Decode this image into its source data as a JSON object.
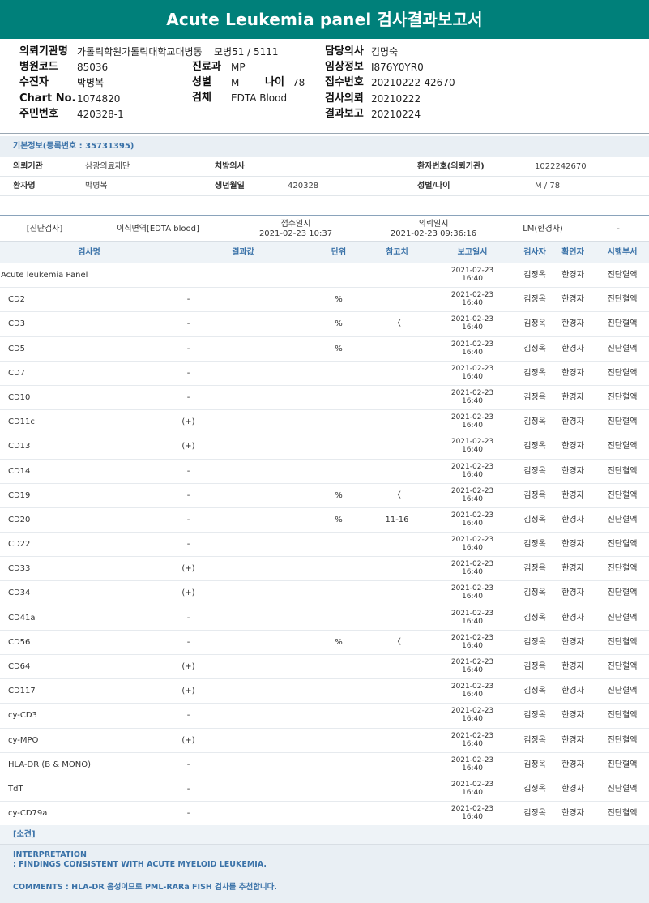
{
  "title": "Acute Leukemia panel 검사결과보고서",
  "header": {
    "institution_label": "의뢰기관명",
    "institution": "가톨릭학원가톨릭대학교대병동",
    "ward": "모병51 / 5111",
    "doctor_label": "담당의사",
    "doctor": "김명숙",
    "hospital_code_label": "병원코드",
    "hospital_code": "85036",
    "dept_label": "진료과",
    "dept": "MP",
    "clinical_label": "임상정보",
    "clinical": "I876Y0YR0",
    "patient_label": "수진자",
    "patient": "박병복",
    "sex_label": "성별",
    "sex": "M",
    "age_label": "나이",
    "age": "78",
    "receipt_label": "접수번호",
    "receipt": "20210222-42670",
    "chart_label": "Chart No.",
    "chart": "1074820",
    "specimen_label": "검체",
    "specimen": "EDTA Blood",
    "request_label": "검사의뢰",
    "request": "20210222",
    "rrn_label": "주민번호",
    "rrn": "420328-1",
    "report_label": "결과보고",
    "report": "20210224"
  },
  "basic": {
    "title": "기본정보(등록번호 : 35731395)",
    "org_label": "의뢰기관",
    "org": "삼광의료재단",
    "presc_label": "처방의사",
    "presc": "",
    "pno_label": "환자번호(의뢰기관)",
    "pno": "1022242670",
    "name_label": "환자명",
    "name": "박병복",
    "birth_label": "생년월일",
    "birth": "420328",
    "sexage_label": "성별/나이",
    "sexage": "M / 78"
  },
  "info": {
    "category": "[진단검사]",
    "specimen": "이식면역[EDTA blood]",
    "receipt_label": "접수일시",
    "receipt": "2021-02-23 10:37",
    "request_label": "의뢰일시",
    "request": "2021-02-23 09:36:16",
    "lm": "LM(한경자)",
    "dash": "-"
  },
  "columns": {
    "name": "검사명",
    "result": "결과값",
    "unit": "단위",
    "ref": "참고치",
    "date": "보고일시",
    "tester": "검사자",
    "checker": "확인자",
    "dept": "시행부서"
  },
  "rows": [
    {
      "name": "Acute leukemia Panel",
      "result": "",
      "unit": "",
      "ref": "",
      "date": "2021-02-23",
      "time": "16:40",
      "tester": "김정옥",
      "checker": "한경자",
      "dept": "진단혈액"
    },
    {
      "name": "CD2",
      "result": "-",
      "unit": "%",
      "ref": "",
      "date": "2021-02-23",
      "time": "16:40",
      "tester": "김정옥",
      "checker": "한경자",
      "dept": "진단혈액"
    },
    {
      "name": "CD3",
      "result": "-",
      "unit": "%",
      "ref": "〈",
      "date": "2021-02-23",
      "time": "16:40",
      "tester": "김정옥",
      "checker": "한경자",
      "dept": "진단혈액"
    },
    {
      "name": "CD5",
      "result": "-",
      "unit": "%",
      "ref": "",
      "date": "2021-02-23",
      "time": "16:40",
      "tester": "김정옥",
      "checker": "한경자",
      "dept": "진단혈액"
    },
    {
      "name": "CD7",
      "result": "-",
      "unit": "",
      "ref": "",
      "date": "2021-02-23",
      "time": "16:40",
      "tester": "김정옥",
      "checker": "한경자",
      "dept": "진단혈액"
    },
    {
      "name": "CD10",
      "result": "-",
      "unit": "",
      "ref": "",
      "date": "2021-02-23",
      "time": "16:40",
      "tester": "김정옥",
      "checker": "한경자",
      "dept": "진단혈액"
    },
    {
      "name": "CD11c",
      "result": "(+)",
      "unit": "",
      "ref": "",
      "date": "2021-02-23",
      "time": "16:40",
      "tester": "김정옥",
      "checker": "한경자",
      "dept": "진단혈액"
    },
    {
      "name": "CD13",
      "result": "(+)",
      "unit": "",
      "ref": "",
      "date": "2021-02-23",
      "time": "16:40",
      "tester": "김정옥",
      "checker": "한경자",
      "dept": "진단혈액"
    },
    {
      "name": "CD14",
      "result": "-",
      "unit": "",
      "ref": "",
      "date": "2021-02-23",
      "time": "16:40",
      "tester": "김정옥",
      "checker": "한경자",
      "dept": "진단혈액"
    },
    {
      "name": "CD19",
      "result": "-",
      "unit": "%",
      "ref": "〈",
      "date": "2021-02-23",
      "time": "16:40",
      "tester": "김정옥",
      "checker": "한경자",
      "dept": "진단혈액"
    },
    {
      "name": "CD20",
      "result": "-",
      "unit": "%",
      "ref": "11-16",
      "date": "2021-02-23",
      "time": "16:40",
      "tester": "김정옥",
      "checker": "한경자",
      "dept": "진단혈액"
    },
    {
      "name": "CD22",
      "result": "-",
      "unit": "",
      "ref": "",
      "date": "2021-02-23",
      "time": "16:40",
      "tester": "김정옥",
      "checker": "한경자",
      "dept": "진단혈액"
    },
    {
      "name": "CD33",
      "result": "(+)",
      "unit": "",
      "ref": "",
      "date": "2021-02-23",
      "time": "16:40",
      "tester": "김정옥",
      "checker": "한경자",
      "dept": "진단혈액"
    },
    {
      "name": "CD34",
      "result": "(+)",
      "unit": "",
      "ref": "",
      "date": "2021-02-23",
      "time": "16:40",
      "tester": "김정옥",
      "checker": "한경자",
      "dept": "진단혈액"
    },
    {
      "name": "CD41a",
      "result": "-",
      "unit": "",
      "ref": "",
      "date": "2021-02-23",
      "time": "16:40",
      "tester": "김정옥",
      "checker": "한경자",
      "dept": "진단혈액"
    },
    {
      "name": "CD56",
      "result": "-",
      "unit": "%",
      "ref": "〈",
      "date": "2021-02-23",
      "time": "16:40",
      "tester": "김정옥",
      "checker": "한경자",
      "dept": "진단혈액"
    },
    {
      "name": "CD64",
      "result": "(+)",
      "unit": "",
      "ref": "",
      "date": "2021-02-23",
      "time": "16:40",
      "tester": "김정옥",
      "checker": "한경자",
      "dept": "진단혈액"
    },
    {
      "name": "CD117",
      "result": "(+)",
      "unit": "",
      "ref": "",
      "date": "2021-02-23",
      "time": "16:40",
      "tester": "김정옥",
      "checker": "한경자",
      "dept": "진단혈액"
    },
    {
      "name": "cy-CD3",
      "result": "-",
      "unit": "",
      "ref": "",
      "date": "2021-02-23",
      "time": "16:40",
      "tester": "김정옥",
      "checker": "한경자",
      "dept": "진단혈액"
    },
    {
      "name": "cy-MPO",
      "result": "(+)",
      "unit": "",
      "ref": "",
      "date": "2021-02-23",
      "time": "16:40",
      "tester": "김정옥",
      "checker": "한경자",
      "dept": "진단혈액"
    },
    {
      "name": "HLA-DR (B & MONO)",
      "result": "-",
      "unit": "",
      "ref": "",
      "date": "2021-02-23",
      "time": "16:40",
      "tester": "김정옥",
      "checker": "한경자",
      "dept": "진단혈액"
    },
    {
      "name": "TdT",
      "result": "-",
      "unit": "",
      "ref": "",
      "date": "2021-02-23",
      "time": "16:40",
      "tester": "김정옥",
      "checker": "한경자",
      "dept": "진단혈액"
    },
    {
      "name": "cy-CD79a",
      "result": "-",
      "unit": "",
      "ref": "",
      "date": "2021-02-23",
      "time": "16:40",
      "tester": "김정옥",
      "checker": "한경자",
      "dept": "진단혈액"
    }
  ],
  "opinion": {
    "title": "[소견]",
    "interp_label": "INTERPRETATION",
    "interp": ": FINDINGS CONSISTENT WITH ACUTE MYELOID LEUKEMIA.",
    "comments": "COMMENTS : HLA-DR 음성이므로 PML-RARa FISH 검사를 추천합니다."
  }
}
